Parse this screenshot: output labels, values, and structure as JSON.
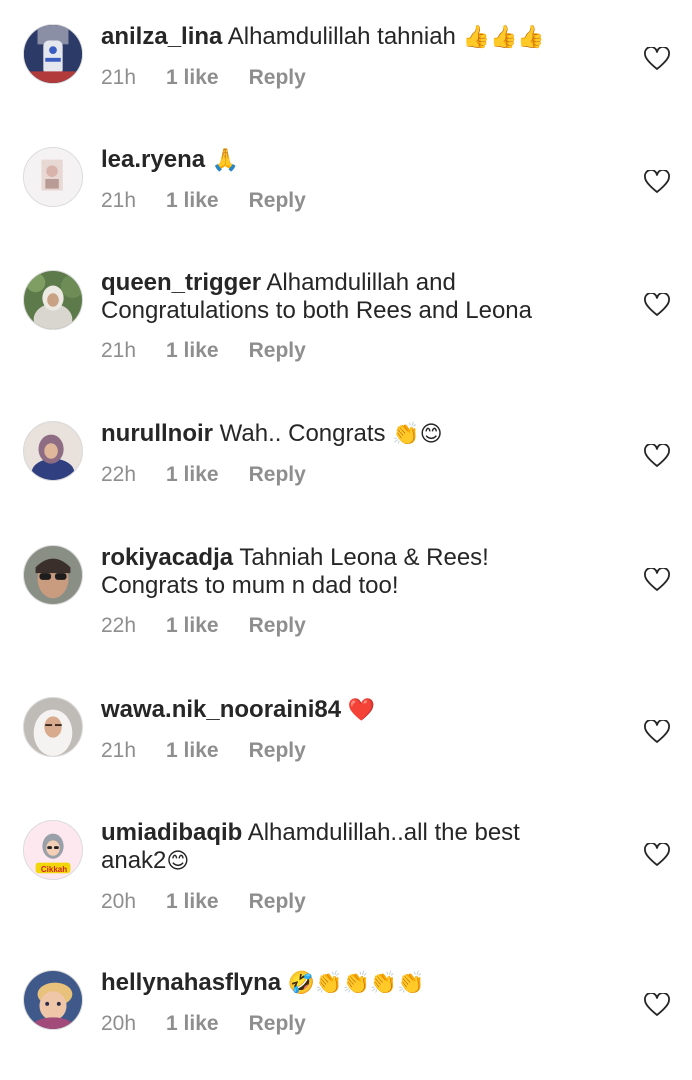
{
  "colors": {
    "text": "#262626",
    "meta": "#8e8e8e",
    "heart_stroke": "#262626"
  },
  "comments": [
    {
      "username": "anilza_lina",
      "text": "Alhamdulillah tahniah",
      "emoji": "👍👍👍",
      "time": "21h",
      "likes": "1 like",
      "reply": "Reply",
      "avatar_icon": "robot-avatar"
    },
    {
      "username": "lea.ryena",
      "text": "",
      "emoji": "🙏",
      "time": "21h",
      "likes": "1 like",
      "reply": "Reply",
      "avatar_icon": "portrait-avatar"
    },
    {
      "username": "queen_trigger",
      "text": "Alhamdulillah and\nCongratulations to both Rees and Leona",
      "emoji": "",
      "time": "21h",
      "likes": "1 like",
      "reply": "Reply",
      "avatar_icon": "hijab-outdoor-avatar"
    },
    {
      "username": "nurullnoir",
      "text": "Wah.. Congrats",
      "emoji": "👏😊",
      "time": "22h",
      "likes": "1 like",
      "reply": "Reply",
      "avatar_icon": "hijab-avatar"
    },
    {
      "username": "rokiyacadja",
      "text": "Tahniah Leona & Rees!\nCongrats to mum n dad too!",
      "emoji": "",
      "time": "22h",
      "likes": "1 like",
      "reply": "Reply",
      "avatar_icon": "sunglasses-avatar"
    },
    {
      "username": "wawa.nik_nooraini84",
      "text": "",
      "emoji": "❤️",
      "time": "21h",
      "likes": "1 like",
      "reply": "Reply",
      "avatar_icon": "white-hijab-avatar"
    },
    {
      "username": "umiadibaqib",
      "text": "Alhamdulillah..all the best\nanak2",
      "emoji": "😊",
      "time": "20h",
      "likes": "1 like",
      "reply": "Reply",
      "avatar_icon": "cartoon-avatar",
      "avatar_label": "Cikkah"
    },
    {
      "username": "hellynahasflyna",
      "text": "",
      "emoji": "🤣👏👏👏👏",
      "time": "20h",
      "likes": "1 like",
      "reply": "Reply",
      "avatar_icon": "cartoon-character-avatar"
    }
  ]
}
